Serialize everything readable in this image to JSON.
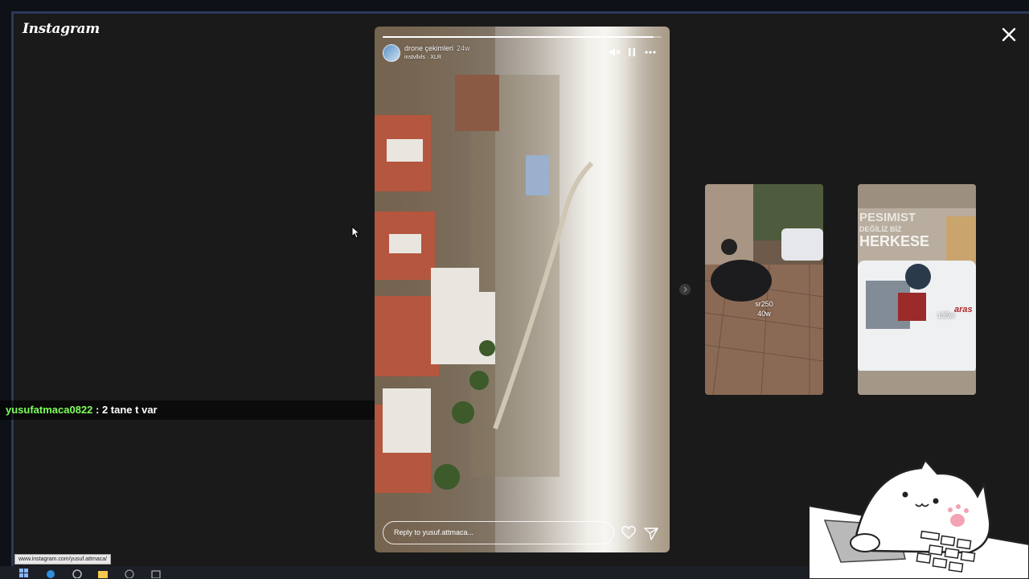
{
  "app": {
    "logo_text": "Instagram"
  },
  "story": {
    "username": "drone çekimleri",
    "time": "24w",
    "music": "instvllvls · XLR",
    "progress": 0.97,
    "reply_placeholder": "Reply to yusuf.attmaca..."
  },
  "previews": [
    {
      "username": "sr250",
      "time": "40w"
    },
    {
      "username": "",
      "time": "135w",
      "overlay_lines": [
        "PESIMIST",
        "DEĞİLİZ BİZ",
        "HERKESE"
      ],
      "van_text": "aras"
    }
  ],
  "chat": {
    "user": "yusufatmaca0822",
    "message": " : 2 tane t var"
  },
  "status_bar": {
    "url": "www.instagram.com/yusuf.attmaca/"
  },
  "colors": {
    "chat_user": "#7dff5a",
    "background": "#1a1a1a"
  },
  "icons": [
    "close-icon",
    "mute-icon",
    "pause-icon",
    "more-icon",
    "heart-icon",
    "send-icon",
    "chevron-right-icon"
  ]
}
